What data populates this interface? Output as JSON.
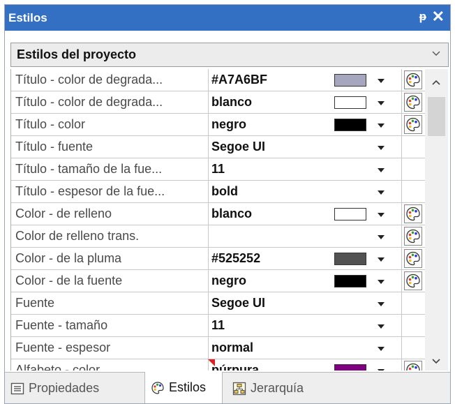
{
  "window": {
    "title": "Estilos",
    "pin_glyph": "ᵽ",
    "close_glyph": "✕"
  },
  "dropdown": {
    "selected": "Estilos del proyecto",
    "icon": "chevron-down-icon"
  },
  "rows": [
    {
      "name": "Título - color de degrada...",
      "value": "#A7A6BF",
      "swatch": "#A7A6BF",
      "dropdown": true,
      "palette": true
    },
    {
      "name": "Título - color de degrada...",
      "value": "blanco",
      "swatch": "#FFFFFF",
      "dropdown": true,
      "palette": true
    },
    {
      "name": "Título - color",
      "value": "negro",
      "swatch": "#000000",
      "dropdown": true,
      "palette": true
    },
    {
      "name": "Título - fuente",
      "value": "Segoe UI",
      "swatch": null,
      "dropdown": true,
      "palette": false
    },
    {
      "name": "Título - tamaño de la fue...",
      "value": "11",
      "swatch": null,
      "dropdown": true,
      "palette": false
    },
    {
      "name": "Título - espesor de la fue...",
      "value": "bold",
      "swatch": null,
      "dropdown": true,
      "palette": false
    },
    {
      "name": "Color - de relleno",
      "value": "blanco",
      "swatch": "#FFFFFF",
      "dropdown": true,
      "palette": true
    },
    {
      "name": "Color de relleno trans.",
      "value": "",
      "swatch": null,
      "dropdown": true,
      "palette": true
    },
    {
      "name": "Color - de la pluma",
      "value": "#525252",
      "swatch": "#525252",
      "dropdown": true,
      "palette": true
    },
    {
      "name": "Color - de la fuente",
      "value": "negro",
      "swatch": "#000000",
      "dropdown": true,
      "palette": true
    },
    {
      "name": "Fuente",
      "value": "Segoe UI",
      "swatch": null,
      "dropdown": true,
      "palette": false
    },
    {
      "name": "Fuente - tamaño",
      "value": "11",
      "swatch": null,
      "dropdown": true,
      "palette": false
    },
    {
      "name": "Fuente - espesor",
      "value": "normal",
      "swatch": null,
      "dropdown": true,
      "palette": false
    },
    {
      "name": "Alfabeto - color",
      "value": "púrpura",
      "swatch": "#800080",
      "dropdown": true,
      "palette": true,
      "marker": true
    }
  ],
  "tabs": [
    {
      "label": "Propiedades",
      "icon": "properties-icon",
      "active": false
    },
    {
      "label": "Estilos",
      "icon": "palette-icon",
      "active": true
    },
    {
      "label": "Jerarquía",
      "icon": "hierarchy-icon",
      "active": false
    }
  ],
  "colors": {
    "titlebar": "#3370C4",
    "accent": "#3370C4"
  }
}
